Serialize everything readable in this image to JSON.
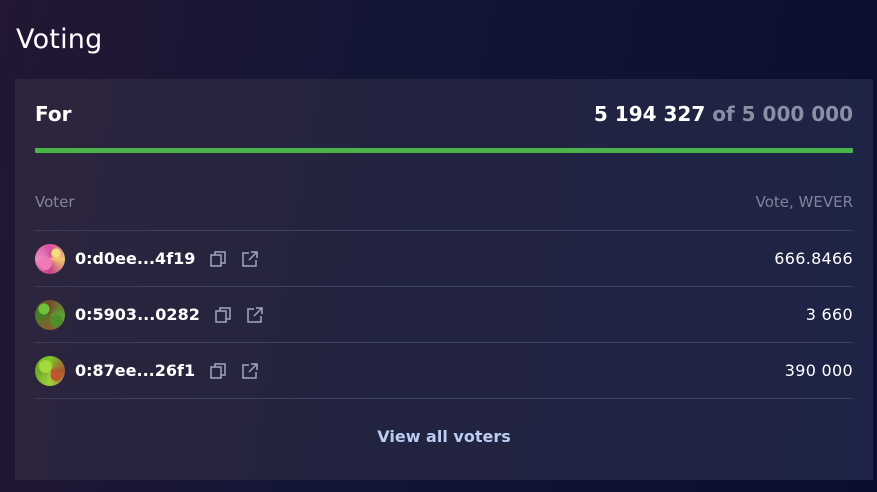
{
  "page": {
    "title": "Voting"
  },
  "result": {
    "label": "For",
    "count": "5 194 327",
    "of_text": "of",
    "total": "5 000 000",
    "progress_fraction": 1.0,
    "progress_color": "#4ab44a"
  },
  "table": {
    "headers": {
      "voter": "Voter",
      "vote": "Vote, WEVER"
    },
    "rows": [
      {
        "address": "0:d0ee...4f19",
        "vote": "666.8466"
      },
      {
        "address": "0:5903...0282",
        "vote": "3 660"
      },
      {
        "address": "0:87ee...26f1",
        "vote": "390 000"
      }
    ]
  },
  "view_all_label": "View all voters",
  "icons": {
    "copy": "copy-icon",
    "external": "external-link-icon"
  }
}
